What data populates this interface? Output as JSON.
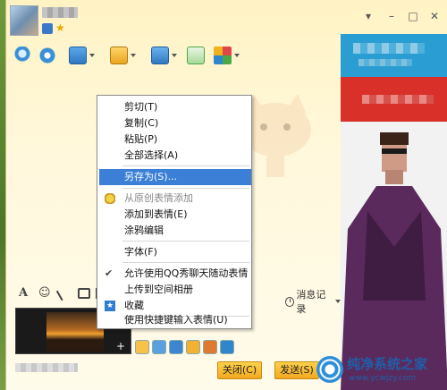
{
  "window": {
    "controls": {
      "minimize": "–",
      "maximize": "□",
      "close": "✕",
      "dropdown": "▾"
    }
  },
  "toolbar": {
    "buttons": [
      {
        "icon": "microphone-icon",
        "color": "#3a8fd6"
      },
      {
        "icon": "webcam-icon",
        "color": "#3a8fd6"
      },
      {
        "icon": "share-screen-icon",
        "color": "#3a8fd6"
      },
      {
        "icon": "send-file-icon",
        "color": "#2f86cc"
      },
      {
        "icon": "remote-assist-icon",
        "color": "#2f86cc"
      },
      {
        "icon": "group-chat-icon",
        "color": "#4aa848"
      },
      {
        "icon": "apps-icon",
        "color": "#e04848"
      }
    ]
  },
  "input_toolbar": {
    "font_icon": "A",
    "emoji_icon": "☺",
    "history_label": "消息记录"
  },
  "buttons": {
    "close_label": "关闭(C)",
    "send_label": "发送(S)"
  },
  "context_menu": {
    "items": [
      {
        "label": "剪切(T)",
        "state": "normal"
      },
      {
        "label": "复制(C)",
        "state": "normal"
      },
      {
        "label": "粘贴(P)",
        "state": "normal"
      },
      {
        "label": "全部选择(A)",
        "state": "normal"
      },
      {
        "label": "另存为(S)...",
        "state": "highlight"
      },
      {
        "label": "从原创表情添加",
        "state": "disabled"
      },
      {
        "label": "添加到表情(E)",
        "state": "normal"
      },
      {
        "label": "涂鸦编辑",
        "state": "normal"
      },
      {
        "label": "字体(F)",
        "state": "normal"
      },
      {
        "label": "允许使用QQ秀聊天随动表情",
        "state": "checked"
      },
      {
        "label": "上传到空间相册",
        "state": "normal"
      },
      {
        "label": "收藏",
        "state": "normal"
      },
      {
        "label": "使用快捷键输入表情(U)",
        "state": "normal"
      }
    ]
  },
  "watermark": {
    "title": "纯净系统之家",
    "url": "www.ycwjzy.com"
  }
}
